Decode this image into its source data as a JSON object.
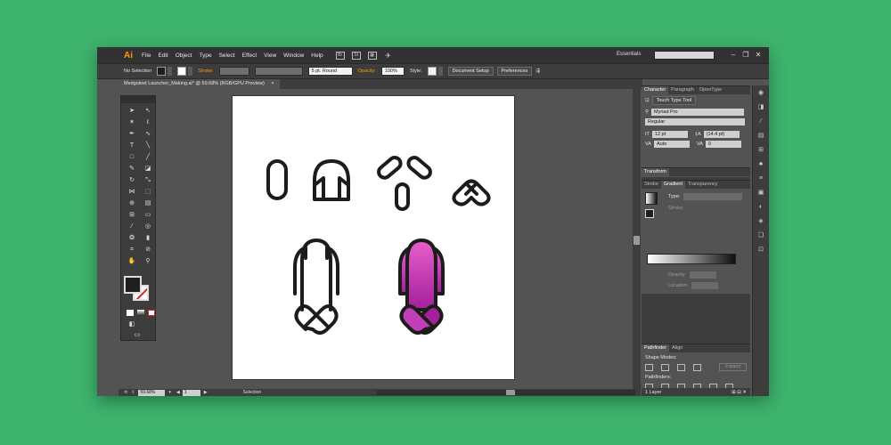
{
  "app": {
    "logo": "Ai",
    "menu": [
      "File",
      "Edit",
      "Object",
      "Type",
      "Select",
      "Effect",
      "View",
      "Window",
      "Help"
    ],
    "workspace": "Essentials",
    "window_controls": [
      "–",
      "❐",
      "✕"
    ]
  },
  "control_bar": {
    "selection_label": "No Selection",
    "stroke_label": "Stroke:",
    "brush_value": "5 pt. Round",
    "opacity_label": "Opacity:",
    "opacity_value": "100%",
    "style_label": "Style:",
    "document_setup": "Document Setup",
    "preferences": "Preferences"
  },
  "document": {
    "tab_title": "Medgoleet Launcher_Making.ai* @ 59.68% (RGB/GPU Preview)"
  },
  "status_bar": {
    "zoom": "59.68%",
    "artboard": "1",
    "tool_status": "Selection"
  },
  "panels": {
    "character": {
      "tabs": [
        "Character",
        "Paragraph",
        "OpenType"
      ],
      "touch_type_tool": "Touch Type Tool",
      "font_family": "Myriad Pro",
      "font_style": "Regular",
      "font_size": "12 pt",
      "leading": "(14.4 pt)",
      "kerning": "Auto",
      "tracking": "0"
    },
    "transform": {
      "tab": "Transform"
    },
    "gradient": {
      "tabs": [
        "Stroke",
        "Gradient",
        "Transparency"
      ],
      "type_label": "Type:",
      "stroke_label": "Stroke:",
      "opacity_label": "Opacity:",
      "location_label": "Location:"
    },
    "pathfinder": {
      "tabs": [
        "Pathfinder",
        "Align"
      ],
      "shape_modes_label": "Shape Modes:",
      "expand_label": "Expand",
      "pathfinders_label": "Pathfinders:"
    },
    "layers": {
      "count_label": "1 Layer"
    }
  },
  "colors": {
    "accent_orange": "#ff9a00",
    "rocket_gradient_top": "#e65fcb",
    "rocket_gradient_bottom": "#a4209c",
    "outline": "#1c1c1c"
  }
}
